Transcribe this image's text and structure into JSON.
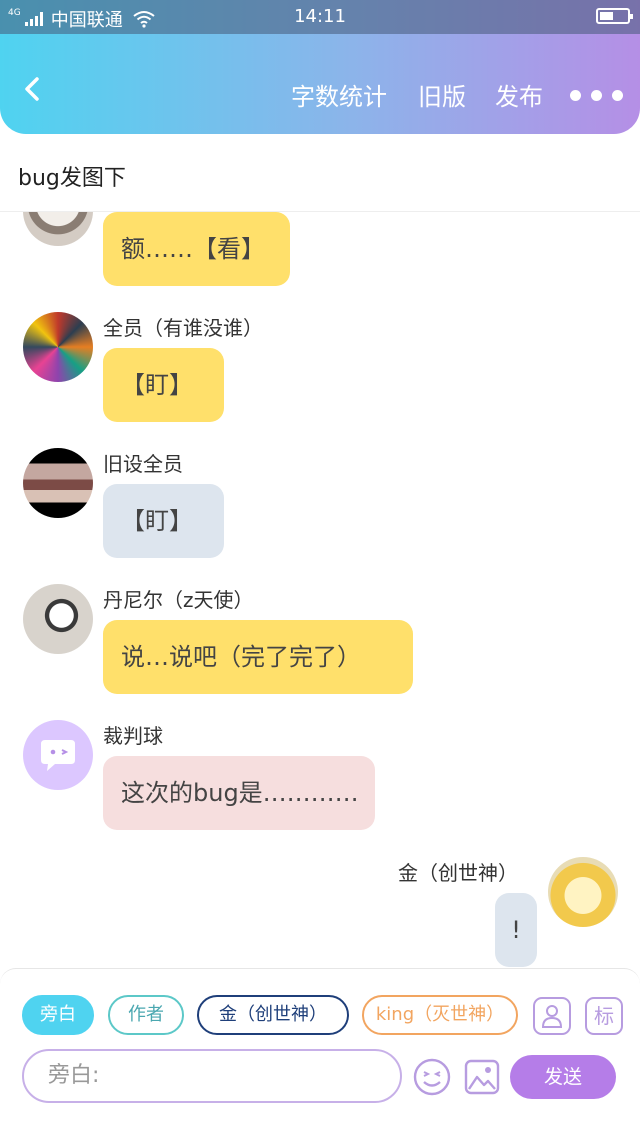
{
  "status_bar": {
    "network": "4G",
    "carrier": "中国联通",
    "time": "14:11"
  },
  "nav": {
    "word_count": "字数统计",
    "old_version": "旧版",
    "publish": "发布"
  },
  "doc": {
    "title": "bug发图下"
  },
  "messages": [
    {
      "sender": "",
      "text": "额……【看】",
      "color": "#ffe06b"
    },
    {
      "sender": "全员（有谁没谁）",
      "text": "【盯】",
      "color": "#ffe06b"
    },
    {
      "sender": "旧设全员",
      "text": "【盯】",
      "color": "#dde5ee"
    },
    {
      "sender": "丹尼尔（z天使）",
      "text": "说…说吧（完了完了）",
      "color": "#ffe06b"
    },
    {
      "sender": "裁判球",
      "text": "这次的bug是…………",
      "color": "#f6dede"
    },
    {
      "sender": "金（创世神）",
      "text": "!",
      "color": "#dde5ee"
    }
  ],
  "composer": {
    "roles": [
      "旁白",
      "作者",
      "金（创世神）",
      "king（灭世神）"
    ],
    "tool_label": "标",
    "input_placeholder": "旁白:",
    "send_label": "发送"
  },
  "colors": {
    "accent_cyan": "#4fd3f0",
    "accent_purple": "#b57de8"
  }
}
